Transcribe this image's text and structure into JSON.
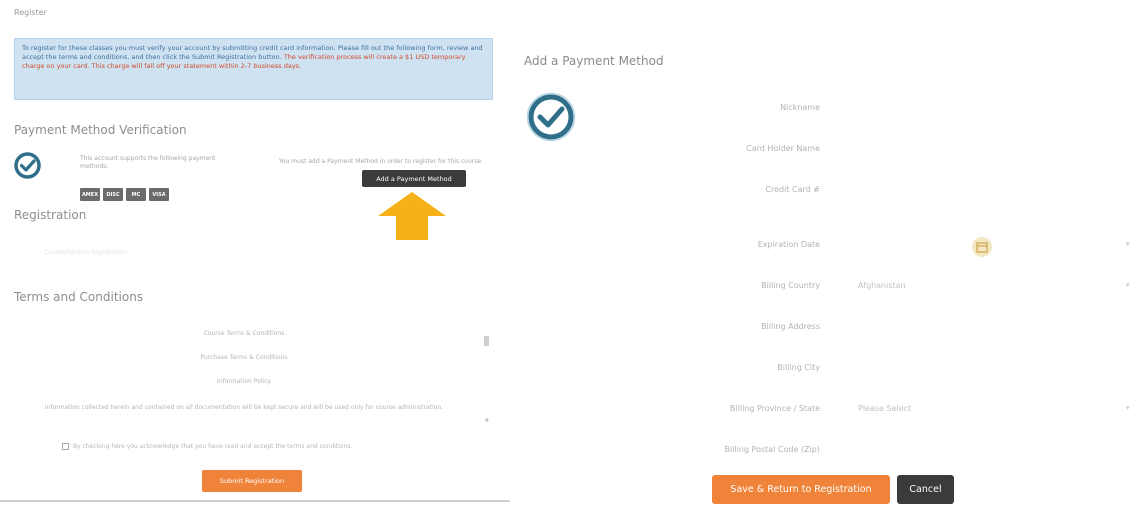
{
  "left": {
    "breadcrumb": "Register",
    "notice": {
      "line_blue": "To register for these classes you must verify your account by submitting credit card information. Please fill out the following form, review and accept the terms and conditions, and then click the Submit Registration button.",
      "line_red": "The verification process will create a $1 USD temporary charge on your card. This charge will fall off your statement within 2-7 business days."
    },
    "payment_verification": {
      "title": "Payment Method Verification",
      "support_text": "This account supports the following payment methods:",
      "cards": [
        "AMEX",
        "DISC",
        "MC",
        "VISA"
      ],
      "need_text": "You must add a Payment Method in order to register for this course.",
      "add_button": "Add a Payment Method"
    },
    "registration": {
      "title": "Registration",
      "subtitle": "Course/Section Registration"
    },
    "terms": {
      "title": "Terms and Conditions",
      "lines": [
        "Course Terms & Conditions",
        "Purchase Terms & Conditions",
        "Information Policy",
        "Information collected herein and contained on all documentation will be kept secure and will be used only for course administration."
      ],
      "agree_text": "By checking here you acknowledge that you have read and accept the terms and conditions.",
      "submit_button": "Submit Registration"
    }
  },
  "right": {
    "title": "Add a Payment Method",
    "fields": [
      {
        "label": "Nickname",
        "value": ""
      },
      {
        "label": "Card Holder Name",
        "value": ""
      },
      {
        "label": "Credit Card #",
        "value": ""
      },
      {
        "label": "Expiration Date",
        "value": ""
      },
      {
        "label": "Billing Country",
        "value": "Afghanistan"
      },
      {
        "label": "Billing Address",
        "value": ""
      },
      {
        "label": "Billing City",
        "value": ""
      },
      {
        "label": "Billing Province / State",
        "value": "Please Select"
      },
      {
        "label": "Billing Postal Code (Zip)",
        "value": ""
      }
    ],
    "save_button": "Save & Return to Registration",
    "cancel_button": "Cancel"
  },
  "colors": {
    "accent": "#f0833a",
    "dark_button": "#3b3b3b",
    "check_teal": "#2f6f8a",
    "notice_bg": "#cfe2f2",
    "arrow": "#f6b11a"
  }
}
